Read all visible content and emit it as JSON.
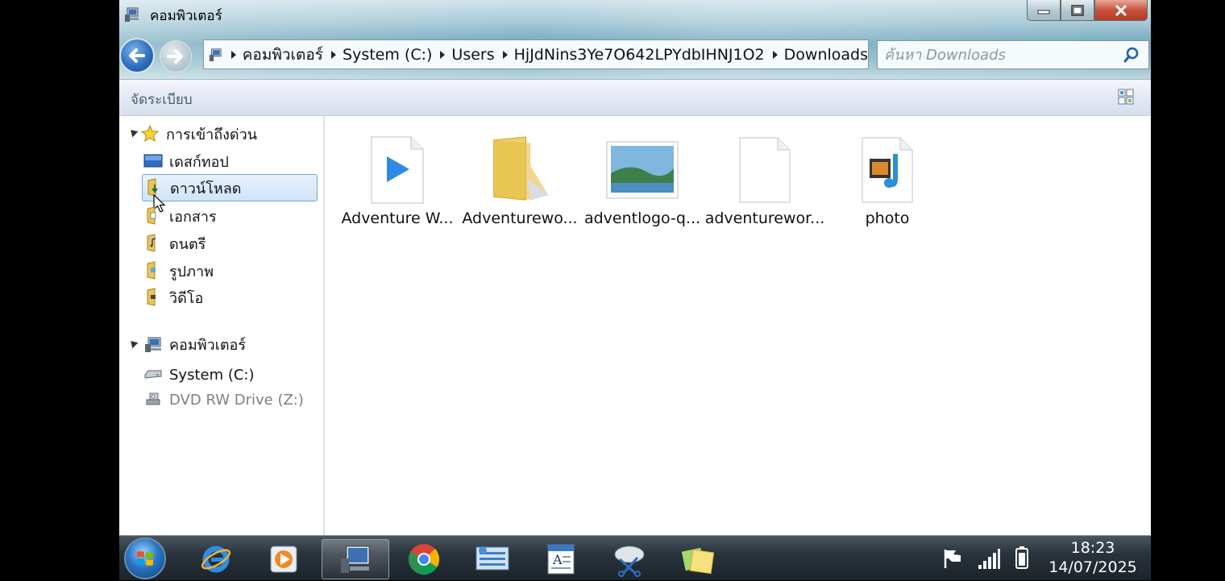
{
  "window": {
    "title": "คอมพิวเตอร์",
    "controls": {
      "minimize": "minimize",
      "maximize": "maximize",
      "close": "close"
    }
  },
  "address": {
    "crumbs": [
      "คอมพิวเตอร์",
      "System (C:)",
      "Users",
      "HjJdNins3Ye7O642LPYdbIHNJ1O2",
      "Downloads"
    ]
  },
  "search": {
    "placeholder": "ค้นหา Downloads"
  },
  "commandbar": {
    "organize_label": "จัดระเบียบ"
  },
  "navpane": {
    "favorites": {
      "label": "การเข้าถึงด่วน",
      "items": [
        {
          "label": "เดสก์ทอป",
          "icon": "desktop-icon"
        },
        {
          "label": "ดาวน์โหลด",
          "icon": "downloads-folder-icon",
          "selected": true
        },
        {
          "label": "เอกสาร",
          "icon": "documents-folder-icon"
        },
        {
          "label": "ดนตรี",
          "icon": "music-folder-icon"
        },
        {
          "label": "รูปภาพ",
          "icon": "pictures-folder-icon"
        },
        {
          "label": "วิดีโอ",
          "icon": "videos-folder-icon"
        }
      ]
    },
    "computer": {
      "label": "คอมพิวเตอร์",
      "items": [
        {
          "label": "System (C:)",
          "icon": "hard-drive-icon"
        },
        {
          "label": "DVD RW Drive (Z:)",
          "icon": "dvd-drive-icon",
          "disabled": true
        }
      ]
    }
  },
  "files": [
    {
      "name": "Adventure W...",
      "icon": "video-file-icon"
    },
    {
      "name": "Adventurewo...",
      "icon": "folder-icon"
    },
    {
      "name": "adventlogo-q...",
      "icon": "image-file-icon"
    },
    {
      "name": "adventurewor...",
      "icon": "blank-file-icon"
    },
    {
      "name": "photo",
      "icon": "media-file-icon"
    }
  ],
  "taskbar": {
    "apps": [
      "internet-explorer-icon",
      "media-player-icon",
      "computer-icon",
      "chrome-icon",
      "control-panel-icon",
      "wordpad-icon",
      "snipping-tool-icon",
      "sticky-notes-icon"
    ],
    "clock": {
      "time": "18:23",
      "date": "14/07/2025"
    }
  },
  "colors": {
    "accent": "#2f6fc1",
    "selection": "#cfe4f9",
    "taskbar": "#1c242b"
  }
}
